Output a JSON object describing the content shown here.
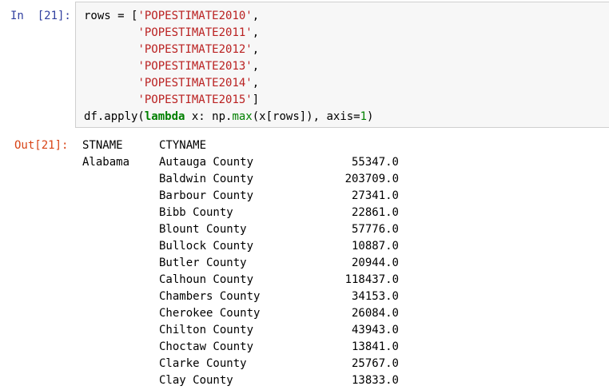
{
  "input_cell": {
    "prompt": "In  [21]:",
    "code": {
      "line1_prefix": "rows = [",
      "line1_str": "'POPESTIMATE2010'",
      "line1_suffix": ",",
      "line2_str": "'POPESTIMATE2011'",
      "line2_suffix": ",",
      "line3_str": "'POPESTIMATE2012'",
      "line3_suffix": ",",
      "line4_str": "'POPESTIMATE2013'",
      "line4_suffix": ",",
      "line5_str": "'POPESTIMATE2014'",
      "line5_suffix": ",",
      "line6_str": "'POPESTIMATE2015'",
      "line6_suffix": "]",
      "line7_a": "df.apply(",
      "line7_kw": "lambda",
      "line7_b": " x: np.",
      "line7_fn": "max",
      "line7_c": "(x[rows]), axis=",
      "line7_num": "1",
      "line7_d": ")"
    }
  },
  "output_cell": {
    "prompt": "Out[21]:",
    "header_stname": "STNAME",
    "header_ctyname": "CTYNAME",
    "state": "Alabama",
    "rows": [
      {
        "county": "Autauga County",
        "value": "55347.0"
      },
      {
        "county": "Baldwin County",
        "value": "203709.0"
      },
      {
        "county": "Barbour County",
        "value": "27341.0"
      },
      {
        "county": "Bibb County",
        "value": "22861.0"
      },
      {
        "county": "Blount County",
        "value": "57776.0"
      },
      {
        "county": "Bullock County",
        "value": "10887.0"
      },
      {
        "county": "Butler County",
        "value": "20944.0"
      },
      {
        "county": "Calhoun County",
        "value": "118437.0"
      },
      {
        "county": "Chambers County",
        "value": "34153.0"
      },
      {
        "county": "Cherokee County",
        "value": "26084.0"
      },
      {
        "county": "Chilton County",
        "value": "43943.0"
      },
      {
        "county": "Choctaw County",
        "value": "13841.0"
      },
      {
        "county": "Clarke County",
        "value": "25767.0"
      },
      {
        "county": "Clay County",
        "value": "13833.0"
      }
    ]
  },
  "colors": {
    "in_prompt": "#303f9f",
    "out_prompt": "#d84315",
    "string": "#ba2121",
    "keyword": "#008000",
    "input_bg": "#f7f7f7",
    "input_border": "#cfcfcf"
  }
}
